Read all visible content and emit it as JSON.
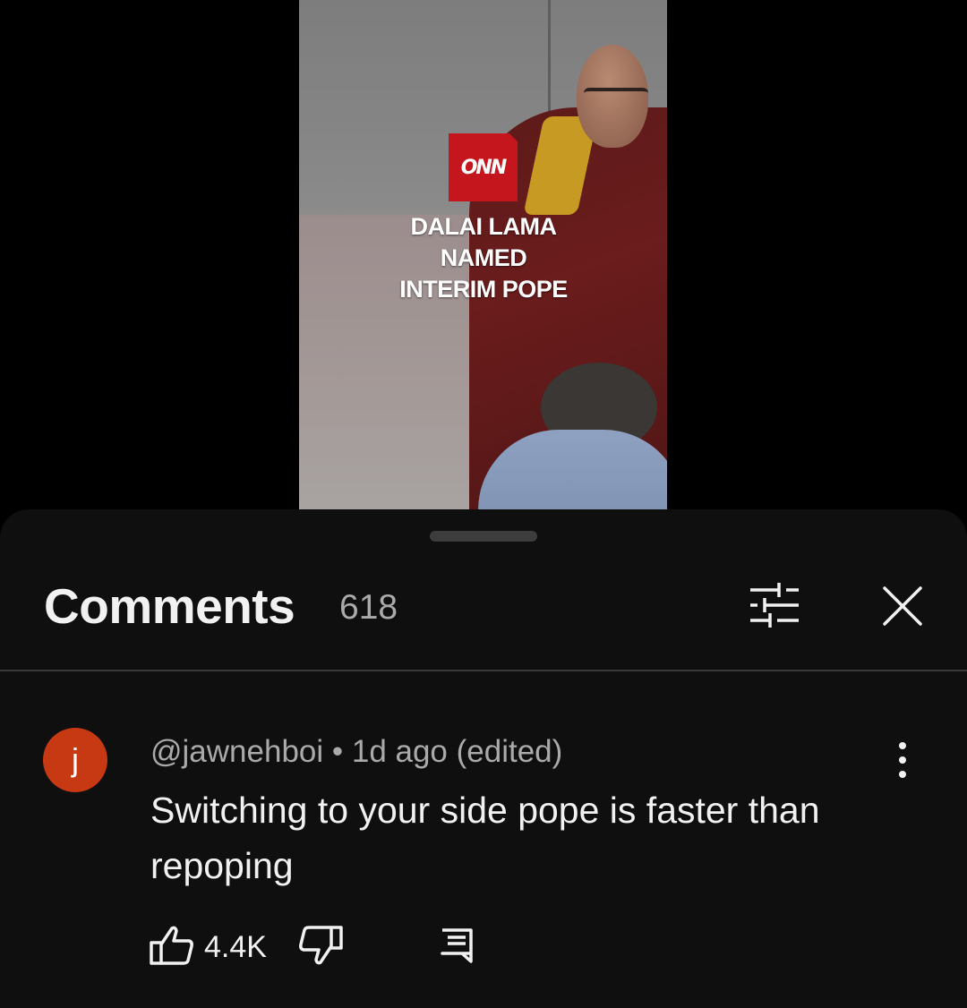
{
  "video": {
    "logo_text": "ONN",
    "headline_lines": [
      "DALAI LAMA",
      "NAMED",
      "INTERIM POPE"
    ]
  },
  "comments_sheet": {
    "title": "Comments",
    "count": "618",
    "icons": {
      "filter": "sort-filter-icon",
      "close": "close-icon"
    }
  },
  "comment": {
    "avatar_letter": "j",
    "avatar_color": "#c63912",
    "meta": "@jawnehboi • 1d ago (edited)",
    "text": "Switching to your side pope is faster than repoping",
    "like_count": "4.4K",
    "icons": {
      "like": "thumbs-up-icon",
      "dislike": "thumbs-down-icon",
      "reply": "reply-icon",
      "more": "more-vert-icon"
    }
  },
  "colors": {
    "sheet_bg": "#0f0f0f",
    "text_primary": "#f1f1f1",
    "text_secondary": "#aaaaaa",
    "logo_red": "#c4161c"
  }
}
